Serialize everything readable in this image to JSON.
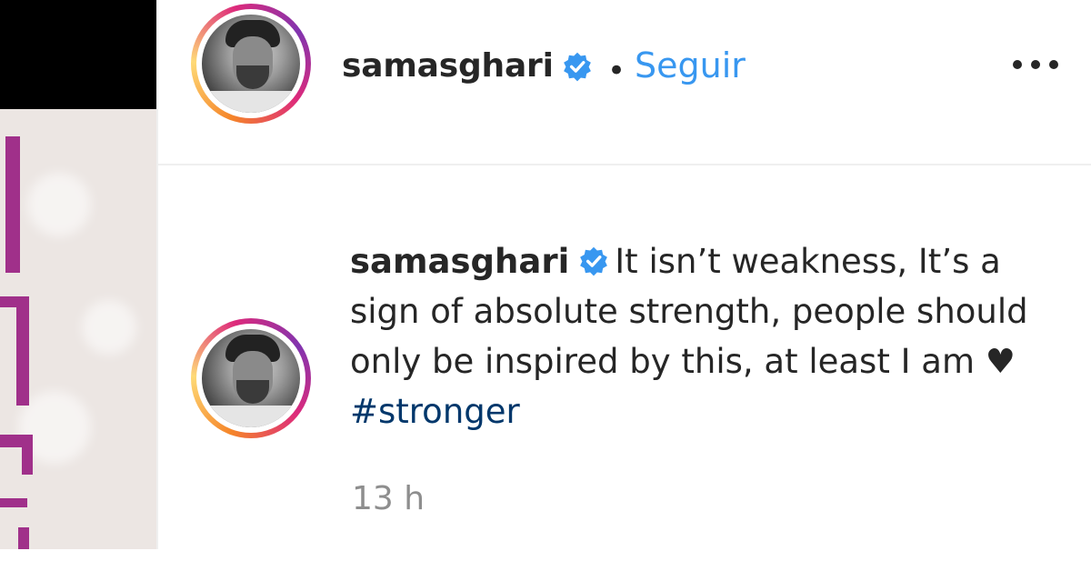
{
  "header": {
    "username": "samasghari",
    "separator": "•",
    "follow_label": "Seguir",
    "more_icon": "more-horizontal-icon"
  },
  "comment": {
    "username": "samasghari",
    "text": "It isn’t weakness, It’s a sign of absolute strength, people should only be inspired by this, at least I am",
    "heart": "♥",
    "hashtag": "#stronger",
    "time": "13 h"
  },
  "colors": {
    "link_blue": "#3897f0",
    "hashtag_blue": "#00376b",
    "verified_blue": "#3897f0",
    "muted_gray": "#8e8e8e"
  }
}
